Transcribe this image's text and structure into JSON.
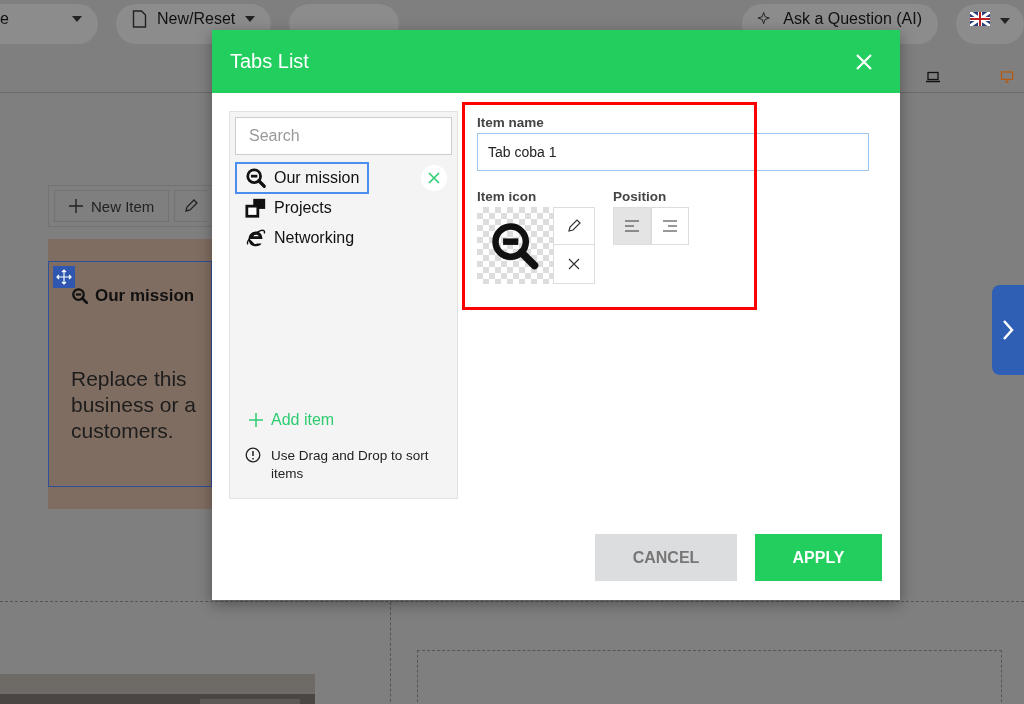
{
  "top_bar": {
    "mode_label": "e",
    "new_reset": "New/Reset",
    "ask_ai": "Ask a Question (AI)"
  },
  "editor": {
    "new_item": "New Item",
    "tab_title": "Our mission",
    "body_lines": [
      "Replace this",
      "business or a",
      "customers."
    ]
  },
  "dialog": {
    "title": "Tabs List",
    "search": {
      "placeholder": "Search"
    },
    "items": [
      {
        "label": "Our mission",
        "selected": true
      },
      {
        "label": "Projects",
        "selected": false
      },
      {
        "label": "Networking",
        "selected": false
      }
    ],
    "add_item": "Add item",
    "hint": "Use Drag and Drop to sort items",
    "item_name": {
      "label": "Item name",
      "value": "Tab coba 1"
    },
    "item_icon": {
      "label": "Item icon"
    },
    "position": {
      "label": "Position",
      "options": [
        {
          "kind": "left",
          "selected": true
        },
        {
          "kind": "right",
          "selected": false
        }
      ]
    },
    "buttons": [
      {
        "kind": "cancel",
        "label": "CANCEL"
      },
      {
        "kind": "apply",
        "label": "APPLY"
      }
    ]
  }
}
